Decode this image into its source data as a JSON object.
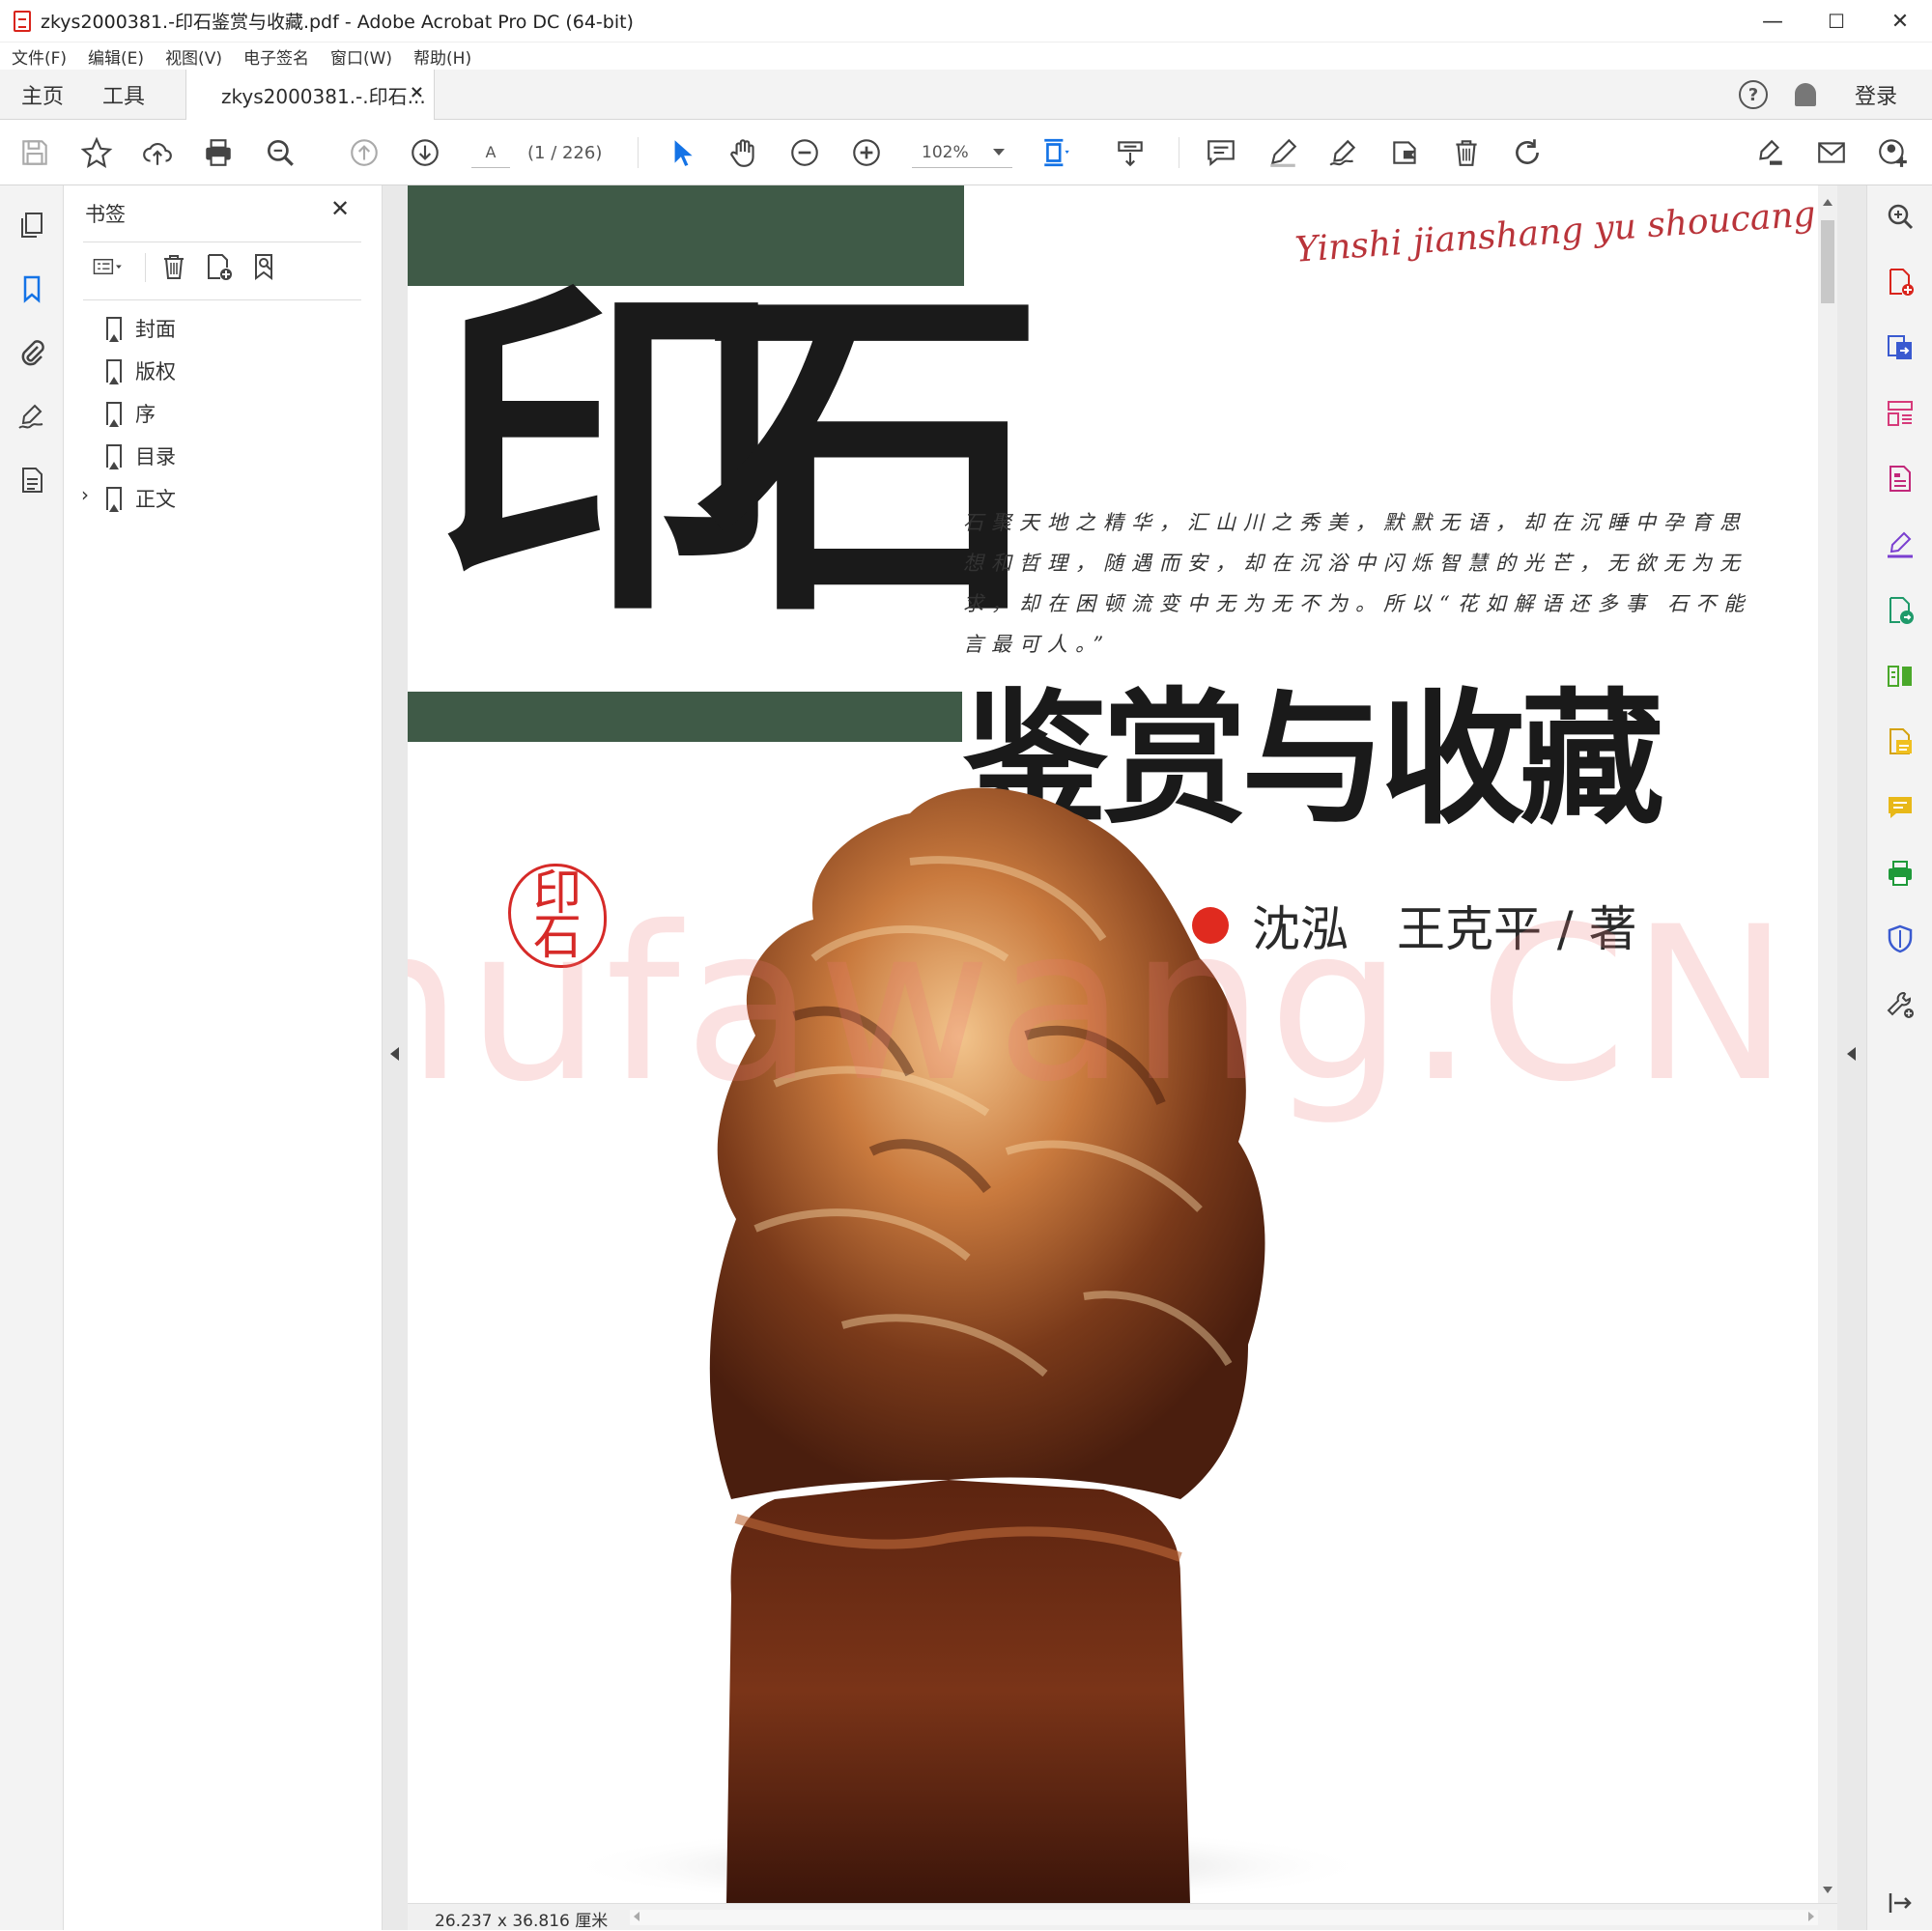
{
  "window": {
    "title": "zkys2000381.-印石鉴赏与收藏.pdf - Adobe Acrobat Pro DC (64-bit)",
    "minimize": "—",
    "maximize": "☐",
    "close": "✕"
  },
  "menu": [
    "文件(F)",
    "编辑(E)",
    "视图(V)",
    "电子签名",
    "窗口(W)",
    "帮助(H)"
  ],
  "tabs": {
    "home": "主页",
    "tools": "工具",
    "document": "zkys2000381.-.印石...",
    "document_close": "×",
    "help": "?",
    "login": "登录"
  },
  "toolbar": {
    "page_input": "A",
    "page_count": "(1 / 226)",
    "zoom": "102%"
  },
  "bookmarks_panel": {
    "title": "书签",
    "close": "✕",
    "items": [
      {
        "label": "封面",
        "expandable": false
      },
      {
        "label": "版权",
        "expandable": false
      },
      {
        "label": "序",
        "expandable": false
      },
      {
        "label": "目录",
        "expandable": false
      },
      {
        "label": "正文",
        "expandable": true
      }
    ],
    "expand_glyph": "›"
  },
  "page": {
    "title_big": [
      "印",
      "石"
    ],
    "script_title": "Yinshi jianshang yu shoucang",
    "intro": "石聚天地之精华，汇山川之秀美，默默无语，却在沉睡中孕育思想和哲理，随遇而安，却在沉浴中闪烁智慧的光芒，无欲无为无求，却在困顿流变中无为无不为。所以“花如解语还多事 石不能言最可人。”",
    "subtitle": "鉴赏与收藏",
    "authors": "沈泓　王克平 / 著",
    "seal": "印石",
    "watermark": "Shufawang.CN"
  },
  "status": {
    "dimensions": "26.237 x 36.816 厘米"
  },
  "colors": {
    "accent_blue": "#1473e6",
    "pdf_red": "#d9241c",
    "cover_green": "#3f5a47",
    "author_dot": "#e02a1f"
  }
}
